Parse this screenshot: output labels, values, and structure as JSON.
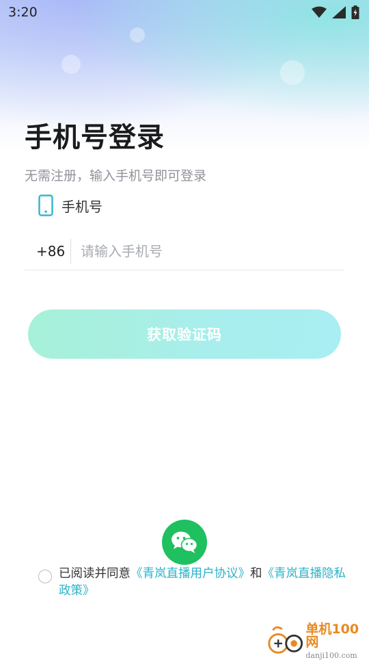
{
  "status_bar": {
    "time": "3:20"
  },
  "login": {
    "title": "手机号登录",
    "subtitle": "无需注册，输入手机号即可登录",
    "phone_label": "手机号",
    "country_code": "+86",
    "phone_placeholder": "请输入手机号",
    "phone_value": "",
    "get_code_label": "获取验证码"
  },
  "agreement": {
    "prefix": "已阅读并同意",
    "user_agreement": "《青岚直播用户协议》",
    "and": "和",
    "privacy_policy": "《青岚直播隐私政策》"
  },
  "watermark": {
    "cn": "单机100网",
    "en": "danji100.com"
  },
  "colors": {
    "accent": "#2bb3c8",
    "button_gradient_start": "#a7f0d8",
    "button_gradient_end": "#a9eef2",
    "wechat_green": "#1fc05f",
    "phone_icon": "#36b6cf"
  },
  "icons": {
    "status": [
      "wifi-icon",
      "cellular-signal-icon",
      "battery-charging-icon"
    ],
    "phone_field": "phone-icon",
    "social_login": "wechat-icon"
  }
}
